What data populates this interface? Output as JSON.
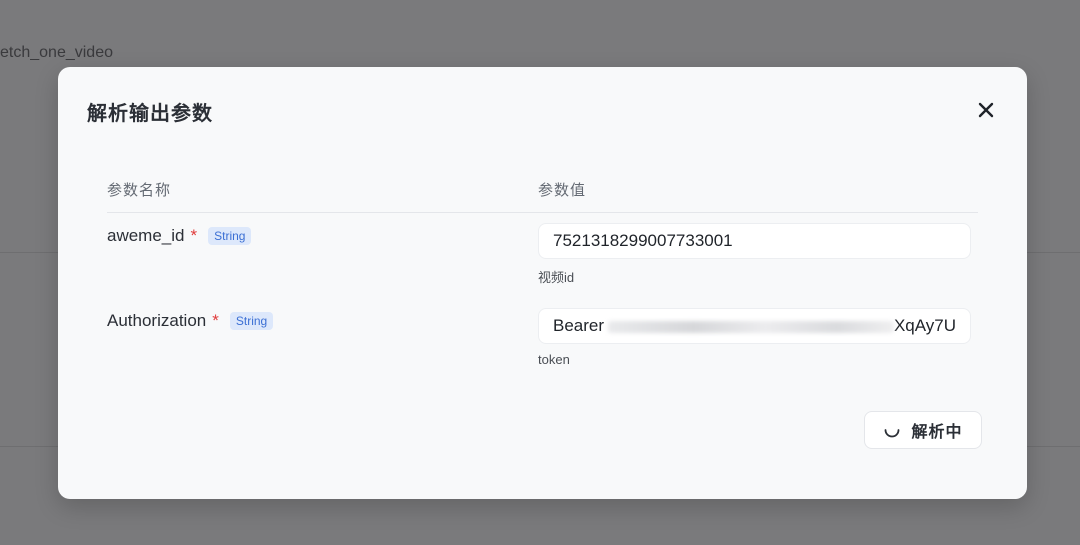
{
  "background": {
    "label": "etch_one_video"
  },
  "modal": {
    "title": "解析输出参数",
    "close_icon": "close-icon",
    "table": {
      "headers": {
        "name": "参数名称",
        "value": "参数值"
      },
      "rows": [
        {
          "name": "aweme_id",
          "required_mark": "*",
          "type": "String",
          "value": "7521318299007733001",
          "hint": "视频id"
        },
        {
          "name": "Authorization",
          "required_mark": "*",
          "type": "String",
          "value_prefix": "Bearer",
          "value_suffix": "XqAy7U",
          "hint": "token"
        }
      ]
    },
    "action_button": {
      "label": "解析中",
      "icon": "loading-spinner-icon"
    }
  },
  "colors": {
    "overlay": "#7a7a7c",
    "required": "#e03b3b",
    "tag_bg": "#dde8fb",
    "tag_text": "#3b6fd4"
  }
}
